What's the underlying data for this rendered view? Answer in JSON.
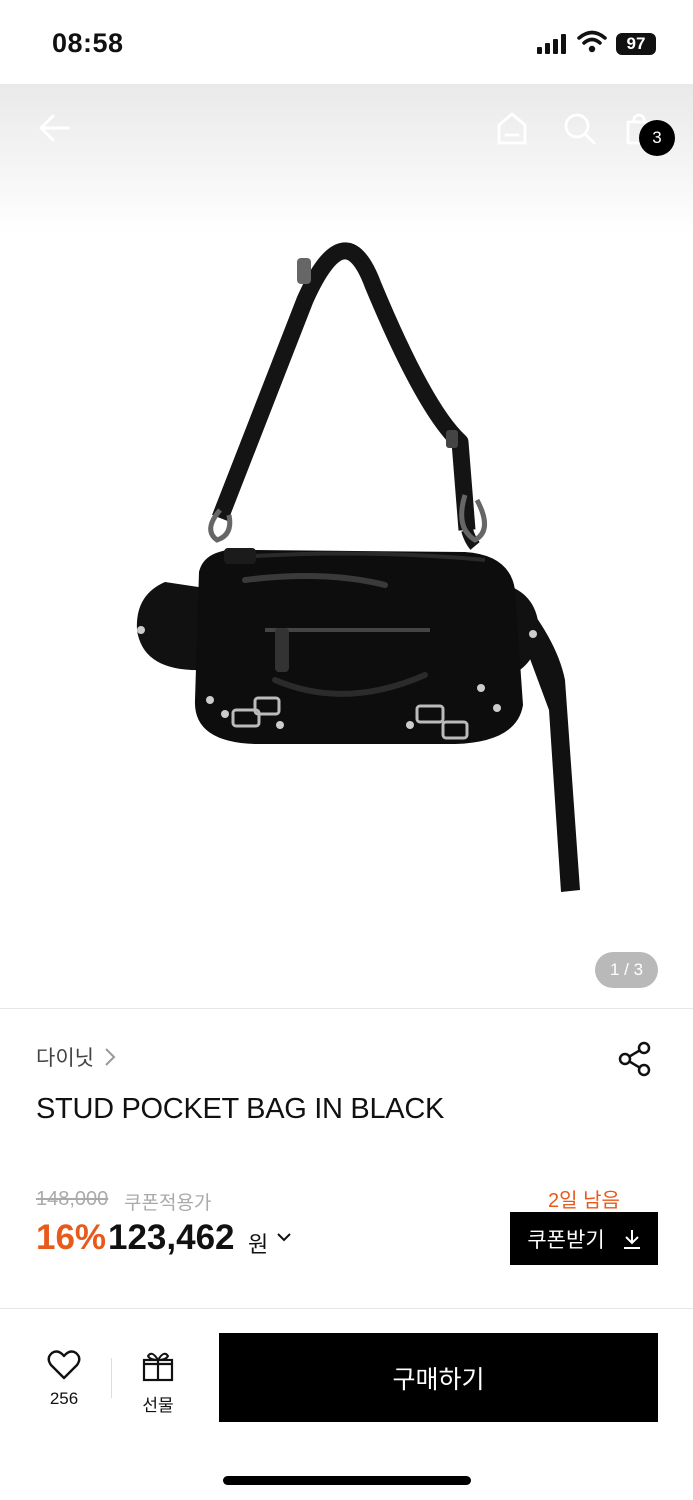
{
  "status_bar": {
    "time": "08:58",
    "battery": "97"
  },
  "header": {
    "cart_count": "3"
  },
  "gallery": {
    "counter": "1 / 3"
  },
  "product": {
    "brand": "다이닛",
    "title": "STUD POCKET BAG IN BLACK",
    "original_price": "148,000",
    "coupon_label": "쿠폰적용가",
    "discount": "16%",
    "price": "123,462",
    "currency": "원"
  },
  "coupon": {
    "days_left": "2일 남음",
    "button_label": "쿠폰받기"
  },
  "bottom_bar": {
    "like_count": "256",
    "gift_label": "선물",
    "buy_label": "구매하기"
  },
  "colors": {
    "accent": "#e85a1b",
    "primary": "#000000"
  }
}
